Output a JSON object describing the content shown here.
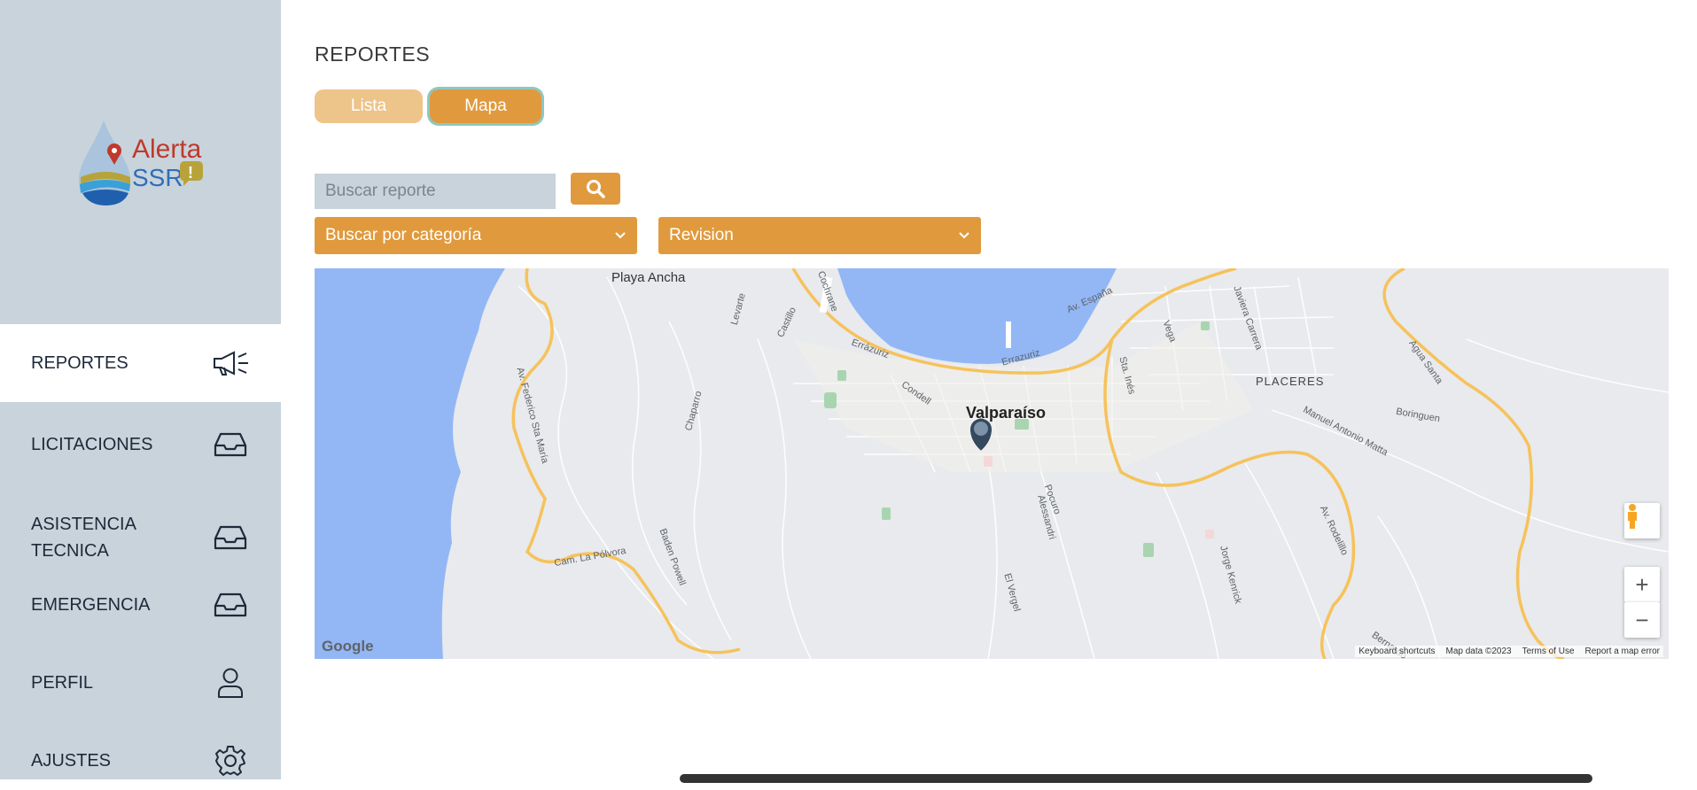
{
  "logo": {
    "line1": "Alerta",
    "line2": "SSR"
  },
  "sidebar": {
    "items": [
      {
        "label": "REPORTES",
        "icon": "megaphone-icon",
        "active": true
      },
      {
        "label": "LICITACIONES",
        "icon": "inbox-icon"
      },
      {
        "label": "ASISTENCIA TECNICA",
        "icon": "inbox-icon"
      },
      {
        "label": "EMERGENCIA",
        "icon": "inbox-icon"
      },
      {
        "label": "PERFIL",
        "icon": "user-icon"
      },
      {
        "label": "AJUSTES",
        "icon": "gear-icon"
      }
    ]
  },
  "main": {
    "title": "REPORTES",
    "view_toggle": {
      "lista": "Lista",
      "mapa": "Mapa",
      "selected": "Mapa"
    },
    "search": {
      "placeholder": "Buscar reporte",
      "button_icon": "search-icon"
    },
    "filters": {
      "category": {
        "value": "Buscar por categoría"
      },
      "status": {
        "value": "Revision"
      }
    }
  },
  "map": {
    "city_label": "Valparaíso",
    "labels": [
      "Playa Ancha",
      "PLACERES",
      "Av. España",
      "Errázuriz",
      "Errazuriz",
      "Cam. La Pólvora",
      "Manuel Antonio Matta",
      "Agua Santa",
      "Baden Powell",
      "Av. Federico Sta María",
      "Chaparro",
      "Condell",
      "Cochrane",
      "Castillo",
      "Levarte",
      "Jorge Kenrick",
      "Av. Rodelillo",
      "El Vergel",
      "Pocuro",
      "Alessandri",
      "Boringuen",
      "Javiera Carrera",
      "Vega",
      "Sta. Inés",
      "Bernardo"
    ],
    "logo": "Google",
    "attribution": [
      "Keyboard shortcuts",
      "Map data ©2023",
      "Terms of Use",
      "Report a map error"
    ],
    "controls": {
      "zoom_in": "+",
      "zoom_out": "−"
    },
    "colors": {
      "water": "#93b7f5",
      "land": "#e8eaed",
      "roads": "#ffffff",
      "highway": "#f6c25b",
      "park": "#a8d5b0",
      "marker": "#34495e"
    }
  }
}
